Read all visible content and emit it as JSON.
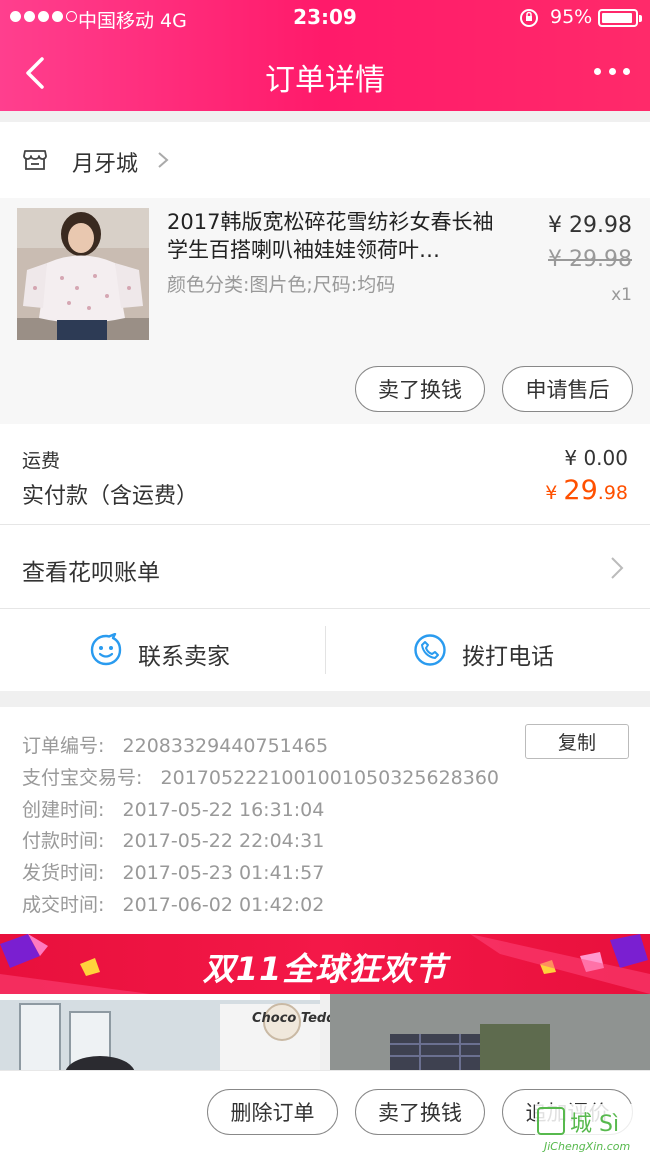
{
  "status_bar": {
    "carrier": "中国移动  4G",
    "time": "23:09",
    "battery_percent": "95%",
    "battery_level": 0.95
  },
  "nav": {
    "title": "订单详情",
    "back_icon": "chevron-left-icon",
    "more_icon": "more-dots-icon"
  },
  "shop": {
    "name": "月牙城",
    "icon": "store-icon"
  },
  "item": {
    "title": "2017韩版宽松碎花雪纺衫女春长袖学生百搭喇叭袖娃娃领荷叶…",
    "spec": "颜色分类:图片色;尺码:均码",
    "price": "¥ 29.98",
    "original_price": "¥ 29.98",
    "quantity": "x1",
    "buttons": [
      "卖了换钱",
      "申请售后"
    ]
  },
  "fees": {
    "shipping_label": "运费",
    "shipping_value": "¥ 0.00",
    "paid_label": "实付款（含运费）",
    "paid_currency": "¥ ",
    "paid_int": "29",
    "paid_dec": ".98",
    "paid_color": "#ff5000"
  },
  "huabei": {
    "label": "查看花呗账单"
  },
  "contact": {
    "chat_label": "联系卖家",
    "phone_label": "拨打电话",
    "icon_color": "#2a9bef"
  },
  "order_info": {
    "copy_label": "复制",
    "lines": [
      {
        "label": "订单编号:",
        "value": "22083329440751465"
      },
      {
        "label": "支付宝交易号:",
        "value": "2017052221001001050325628360"
      },
      {
        "label": "创建时间:",
        "value": "2017-05-22 16:31:04"
      },
      {
        "label": "付款时间:",
        "value": "2017-05-22 22:04:31"
      },
      {
        "label": "发货时间:",
        "value": "2017-05-23 01:41:57"
      },
      {
        "label": "成交时间:",
        "value": "2017-06-02 01:42:02"
      }
    ]
  },
  "banner": {
    "text": "双11全球狂欢节"
  },
  "recommend": {
    "brand": "Choco Teddy"
  },
  "bottom_bar": {
    "buttons": [
      "删除订单",
      "卖了换钱",
      "追加评价"
    ]
  },
  "watermark": {
    "text": "城 Sì",
    "sub": "JiChengXin.com"
  },
  "colors": {
    "header": "#ff1a6a",
    "accent": "#ff5000"
  }
}
